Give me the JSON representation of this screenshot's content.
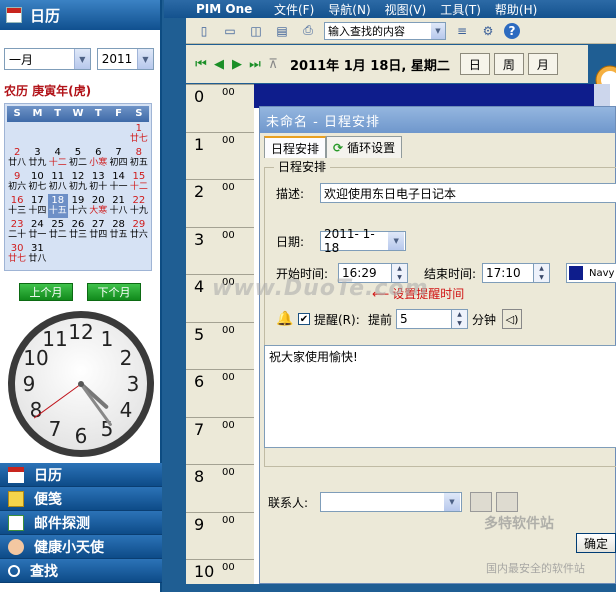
{
  "left_panel": {
    "header": "日历",
    "month_select": "一月",
    "year_select": "2011",
    "lunar_title": "农历 庚寅年(虎)",
    "weekdays": [
      "S",
      "M",
      "T",
      "W",
      "T",
      "F",
      "S"
    ],
    "calendar_rows": [
      [
        {
          "d": "",
          "l": ""
        },
        {
          "d": "",
          "l": ""
        },
        {
          "d": "",
          "l": ""
        },
        {
          "d": "",
          "l": ""
        },
        {
          "d": "",
          "l": ""
        },
        {
          "d": "",
          "l": ""
        },
        {
          "d": "1",
          "l": "廿七"
        }
      ],
      [
        {
          "d": "2",
          "l": "廿八"
        },
        {
          "d": "3",
          "l": "廿九"
        },
        {
          "d": "4",
          "l": "十二"
        },
        {
          "d": "5",
          "l": "初二"
        },
        {
          "d": "6",
          "l": "小寒"
        },
        {
          "d": "7",
          "l": "初四"
        },
        {
          "d": "8",
          "l": "初五"
        }
      ],
      [
        {
          "d": "9",
          "l": "初六"
        },
        {
          "d": "10",
          "l": "初七"
        },
        {
          "d": "11",
          "l": "初八"
        },
        {
          "d": "12",
          "l": "初九"
        },
        {
          "d": "13",
          "l": "初十"
        },
        {
          "d": "14",
          "l": "十一"
        },
        {
          "d": "15",
          "l": "十二"
        }
      ],
      [
        {
          "d": "16",
          "l": "十三"
        },
        {
          "d": "17",
          "l": "十四"
        },
        {
          "d": "18",
          "l": "十五"
        },
        {
          "d": "19",
          "l": "十六"
        },
        {
          "d": "20",
          "l": "大寒"
        },
        {
          "d": "21",
          "l": "十八"
        },
        {
          "d": "22",
          "l": "十九"
        }
      ],
      [
        {
          "d": "23",
          "l": "二十"
        },
        {
          "d": "24",
          "l": "廿一"
        },
        {
          "d": "25",
          "l": "廿二"
        },
        {
          "d": "26",
          "l": "廿三"
        },
        {
          "d": "27",
          "l": "廿四"
        },
        {
          "d": "28",
          "l": "廿五"
        },
        {
          "d": "29",
          "l": "廿六"
        }
      ],
      [
        {
          "d": "30",
          "l": "廿七"
        },
        {
          "d": "31",
          "l": "廿八"
        },
        {
          "d": "",
          "l": ""
        },
        {
          "d": "",
          "l": ""
        },
        {
          "d": "",
          "l": ""
        },
        {
          "d": "",
          "l": ""
        },
        {
          "d": "",
          "l": ""
        }
      ]
    ],
    "selected_day": "18",
    "prev_month": "上个月",
    "next_month": "下个月",
    "clock": {
      "hour": 4,
      "minute": 24,
      "second": 39
    },
    "clock_numbers": [
      "12",
      "1",
      "2",
      "3",
      "4",
      "5",
      "6",
      "7",
      "8",
      "9",
      "10",
      "11"
    ],
    "nav_items": [
      "日历",
      "便笺",
      "邮件探测",
      "健康小天使",
      "查找"
    ]
  },
  "title_bar": {
    "app_name": "PIM One",
    "menu": [
      "文件(F)",
      "导航(N)",
      "视图(V)",
      "工具(T)",
      "帮助(H)"
    ]
  },
  "toolbar": {
    "search_placeholder": "输入查找的内容"
  },
  "date_bar": {
    "date_text": "2011年 1月 18日, 星期二",
    "view_tabs": [
      "日",
      "周",
      "月"
    ]
  },
  "hours": [
    {
      "h": "0",
      "m": "00"
    },
    {
      "h": "1",
      "m": "00"
    },
    {
      "h": "2",
      "m": "00"
    },
    {
      "h": "3",
      "m": "00"
    },
    {
      "h": "4",
      "m": "00"
    },
    {
      "h": "5",
      "m": "00"
    },
    {
      "h": "6",
      "m": "00"
    },
    {
      "h": "7",
      "m": "00"
    },
    {
      "h": "8",
      "m": "00"
    },
    {
      "h": "9",
      "m": "00"
    },
    {
      "h": "10",
      "m": "00"
    }
  ],
  "dialog": {
    "title": "未命名 - 日程安排",
    "tabs": [
      "日程安排",
      "循环设置"
    ],
    "group_title": "日程安排",
    "desc_label": "描述:",
    "desc_value": "欢迎使用东日电子日记本",
    "date_label": "日期:",
    "date_value": "2011- 1-18",
    "start_label": "开始时间:",
    "start_value": "16:29",
    "end_label": "结束时间:",
    "end_value": "17:10",
    "color_value": "Navy",
    "annotation": "设置提醒时间",
    "remind_label": "提醒(R):",
    "advance_label": "提前",
    "advance_value": "5",
    "minute_label": "分钟",
    "memo": "祝大家使用愉快!",
    "contact_label": "联系人:",
    "ok": "确定"
  },
  "watermark": {
    "main": "www.DuoTe.com",
    "brand": "多特软件站",
    "sub": "国内最安全的软件站"
  }
}
